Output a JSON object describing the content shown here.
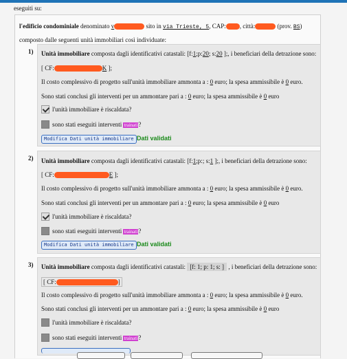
{
  "header": {
    "text": "eseguiti su:"
  },
  "intro": {
    "bold_lead": "l'edificio condominiale",
    "t_denominato": " denominato ",
    "v_prefix": "v",
    "t_sito_in": " sito in ",
    "street": "via Trieste, 5",
    "t_cap": ", CAP:",
    "t_citta": ", città:",
    "t_prov": " (prov. ",
    "prov_code": "BS",
    "t_close": ")",
    "line2": "composto dalle seguenti unità immobiliari così individuate:"
  },
  "units": [
    {
      "number": "1)",
      "title_bold": "Unità immobiliare",
      "title_rest": " composta dagli identificativi catastali: [f:",
      "f_val": "1",
      "p_label": ";p:",
      "p_val": "20",
      "s_label": "; s:",
      "s_val": "20",
      "title_end": " ];, i beneficiari della detrazione sono:",
      "cf_open": "[ CF:",
      "cf_tail": "K",
      "cf_close": " ];",
      "cost_text": "Il costo complessivo di progetto sull'unità immobiliare ammonta a : ",
      "cost_val": "0",
      "cost_rest": " euro; la spesa ammissibile è ",
      "cost_val2": "0",
      "cost_end": " euro.",
      "concl_text": "Sono stati conclusi gli interventi per un ammontare pari a : ",
      "concl_val": "0",
      "concl_rest": " euro; la spesa ammissibile è ",
      "concl_val2": "0",
      "concl_end": " euro",
      "heated_label": "l'unità immobiliare è riscaldata?",
      "trainati_pre": "sono stati eseguiti interventi ",
      "trainati_tag": "trainati",
      "trainati_end": "?",
      "edit_button": "Modifica Dati unità immobiliare",
      "status": "Dati validati"
    },
    {
      "number": "2)",
      "title_bold": "Unità immobiliare",
      "title_rest": " composta dagli identificativi catastali: [f:",
      "f_val": "1",
      "p_label": ";p:",
      "p_val": "",
      "s_label": "; s:",
      "s_val": "1",
      "title_end": " ];, i beneficiari della detrazione sono:",
      "cf_open": "[ CF:",
      "cf_tail": "E",
      "cf_close": " ];",
      "cost_text": "Il costo complessivo di progetto sull'unità immobiliare ammonta a : ",
      "cost_val": "0",
      "cost_rest": " euro; la spesa ammissibile è ",
      "cost_val2": "0",
      "cost_end": " euro.",
      "concl_text": "Sono stati conclusi gli interventi per un ammontare pari a : ",
      "concl_val": "0",
      "concl_rest": " euro; la spesa ammissibile è ",
      "concl_val2": "0",
      "concl_end": " euro",
      "heated_label": "l'unità immobiliare è riscaldata?",
      "trainati_pre": "sono stati eseguiti interventi ",
      "trainati_tag": "trainati",
      "trainati_end": "?",
      "edit_button": "Modifica Dati unità immobiliare",
      "status": "Dati validati"
    },
    {
      "number": "3)",
      "title_bold": "Unità immobiliare",
      "title_rest": " composta dagli identificativi catastali: ",
      "f_box": "[f: 1; p: 1; s: ]",
      "title_end": " , i beneficiari della detrazione sono:",
      "cf_open": "[ CF:",
      "cf_close": "]",
      "cost_text": "Il costo complessivo di progetto sull'unità immobiliare ammonta a : ",
      "cost_val": "0",
      "cost_rest": " euro; la spesa ammissibile è ",
      "cost_val2": "0",
      "cost_end": " euro.",
      "concl_text": "Sono stati conclusi gli interventi per un ammontare pari a : ",
      "concl_val": "0",
      "concl_rest": " euro; la spesa ammissibile è ",
      "concl_val2": "0",
      "concl_end": " euro",
      "heated_label": "l'unità immobiliare è riscaldata?",
      "trainati_pre": "sono stati eseguiti interventi ",
      "trainati_tag": "trainati",
      "trainati_end": "?"
    }
  ],
  "colors": {
    "redaction": "#ff5a1f",
    "status_ok": "#1b8a1b",
    "accent_bar": "#1f73b7",
    "trainati_tag": "#d040d0"
  }
}
